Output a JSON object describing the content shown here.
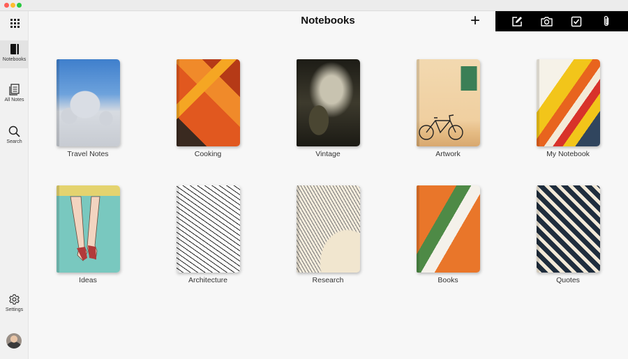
{
  "window": {
    "controls": [
      "close",
      "minimize",
      "zoom"
    ]
  },
  "header": {
    "title": "Notebooks",
    "add_label": "+"
  },
  "toolbar": {
    "buttons": [
      {
        "icon": "edit-note-icon"
      },
      {
        "icon": "camera-icon"
      },
      {
        "icon": "checklist-icon"
      },
      {
        "icon": "attachment-icon"
      }
    ]
  },
  "sidebar": {
    "items": [
      {
        "label": "Notebooks",
        "icon": "notebook-icon"
      },
      {
        "label": "All Notes",
        "icon": "notes-icon"
      },
      {
        "label": "Search",
        "icon": "search-icon"
      },
      {
        "label": "Settings",
        "icon": "gear-icon"
      }
    ]
  },
  "notebooks": [
    {
      "title": "Travel Notes"
    },
    {
      "title": "Cooking"
    },
    {
      "title": "Vintage"
    },
    {
      "title": "Artwork"
    },
    {
      "title": "My Notebook"
    },
    {
      "title": "Ideas"
    },
    {
      "title": "Architecture"
    },
    {
      "title": "Research"
    },
    {
      "title": "Books"
    },
    {
      "title": "Quotes"
    }
  ]
}
